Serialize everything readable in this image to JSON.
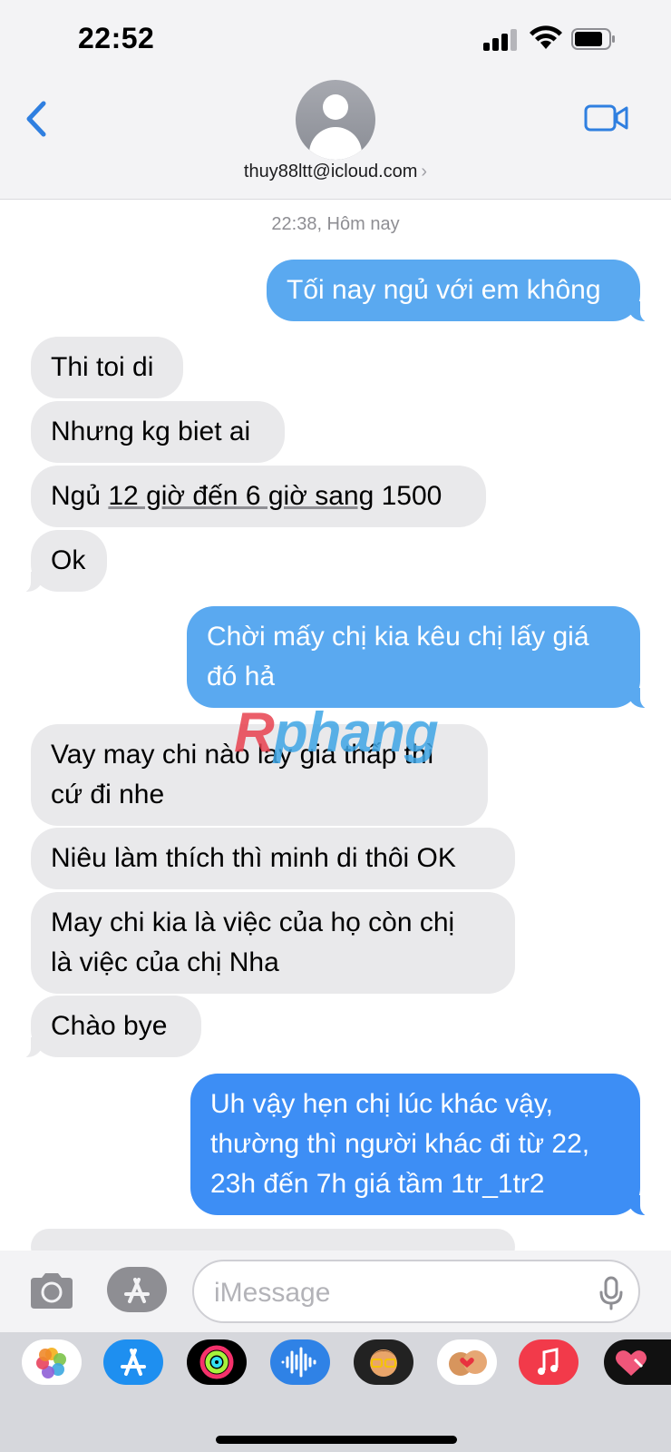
{
  "status_bar": {
    "time": "22:52"
  },
  "header": {
    "contact": "thuy88ltt@icloud.com",
    "chevron": "›"
  },
  "conversation": {
    "timestamp": "22:38, Hôm nay"
  },
  "messages": [
    {
      "from": "me",
      "text": "Tối nay ngủ với em không"
    },
    {
      "from": "them",
      "text": "Thi toi di"
    },
    {
      "from": "them",
      "text": "Nhưng kg biet ai"
    },
    {
      "from": "them",
      "parts": [
        "Ngủ ",
        "12 giờ đến 6 giờ sang",
        " 1500"
      ]
    },
    {
      "from": "them",
      "text": "Ok"
    },
    {
      "from": "me",
      "lines": [
        "Chời mấy chị kia kêu chị lấy giá",
        "đó hả"
      ]
    },
    {
      "from": "them",
      "lines": [
        "Vay may chi nào lay gia thấp thì",
        "cứ đi nhe"
      ]
    },
    {
      "from": "them",
      "text": "Niêu làm thích thì minh di thôi OK"
    },
    {
      "from": "them",
      "lines": [
        "May chi kia là việc của họ còn chị",
        "là việc của chị Nha"
      ]
    },
    {
      "from": "them",
      "text": "Chào bye"
    },
    {
      "from": "me",
      "lines": [
        "Uh vậy hẹn chị lúc khác vậy,",
        "thường thì người khác đi từ 22,",
        "23h đến 7h giá tầm 1tr_1tr2"
      ]
    }
  ],
  "watermark": {
    "first": "R",
    "rest": "phang"
  },
  "composer": {
    "placeholder": "iMessage"
  },
  "icons": [
    "back-chevron-icon",
    "facetime-video-icon",
    "camera-icon",
    "app-store-icon",
    "microphone-icon",
    "photos-icon",
    "activity-icon",
    "voice-memo-icon",
    "memoji-icon",
    "music-icon",
    "heart-sticker-icon"
  ],
  "colors": {
    "outgoing": "#3d8ef5",
    "incoming": "#e9e9eb",
    "accent": "#2f7fe0"
  }
}
